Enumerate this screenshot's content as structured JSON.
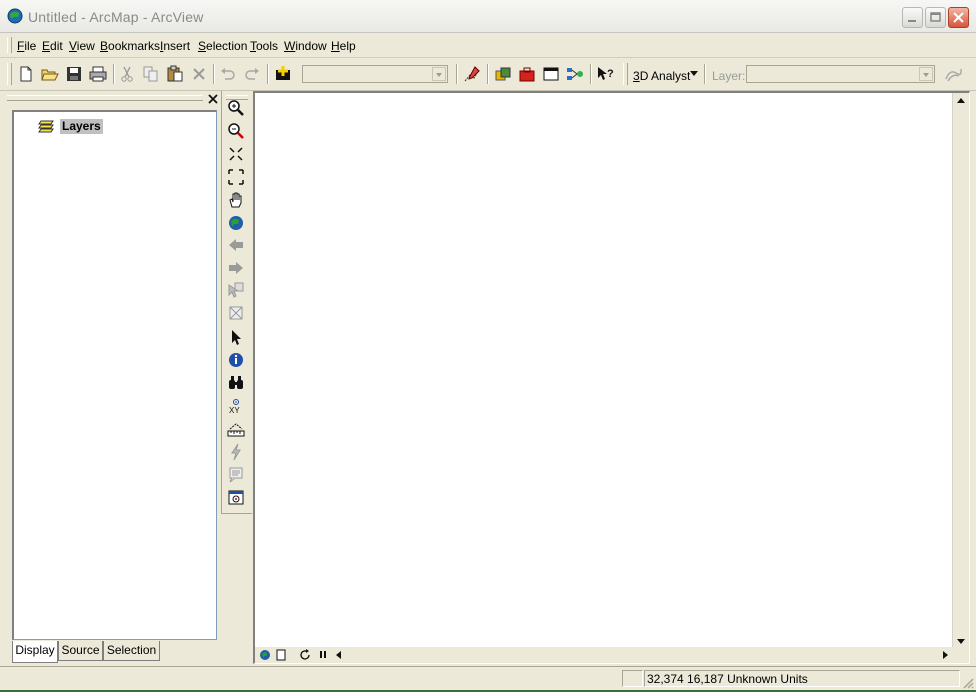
{
  "window": {
    "title": "Untitled - ArcMap - ArcView"
  },
  "menus": [
    {
      "key": "F",
      "rest": "ile"
    },
    {
      "key": "E",
      "rest": "dit"
    },
    {
      "key": "V",
      "rest": "iew"
    },
    {
      "key": "B",
      "rest": "ookmarks"
    },
    {
      "key": "I",
      "rest": "nsert"
    },
    {
      "key": "S",
      "rest": "election"
    },
    {
      "key": "T",
      "rest": "ools"
    },
    {
      "key": "W",
      "rest": "indow"
    },
    {
      "key": "H",
      "rest": "elp"
    }
  ],
  "toolbar": {
    "analyst_key": "3",
    "analyst_rest": "D Analyst",
    "layer_label": "Layer:",
    "scale_value": "",
    "layer_value": ""
  },
  "toc": {
    "root_label": "Layers",
    "tabs": [
      "Display",
      "Source",
      "Selection"
    ],
    "active_tab": "Display"
  },
  "status": {
    "coordinates": "32,374  16,187 Unknown Units"
  },
  "colors": {
    "chrome": "#ece9d8",
    "title_text": "#8a8a8a",
    "close_button": "#d9543b",
    "map_background": "#ffffff"
  }
}
